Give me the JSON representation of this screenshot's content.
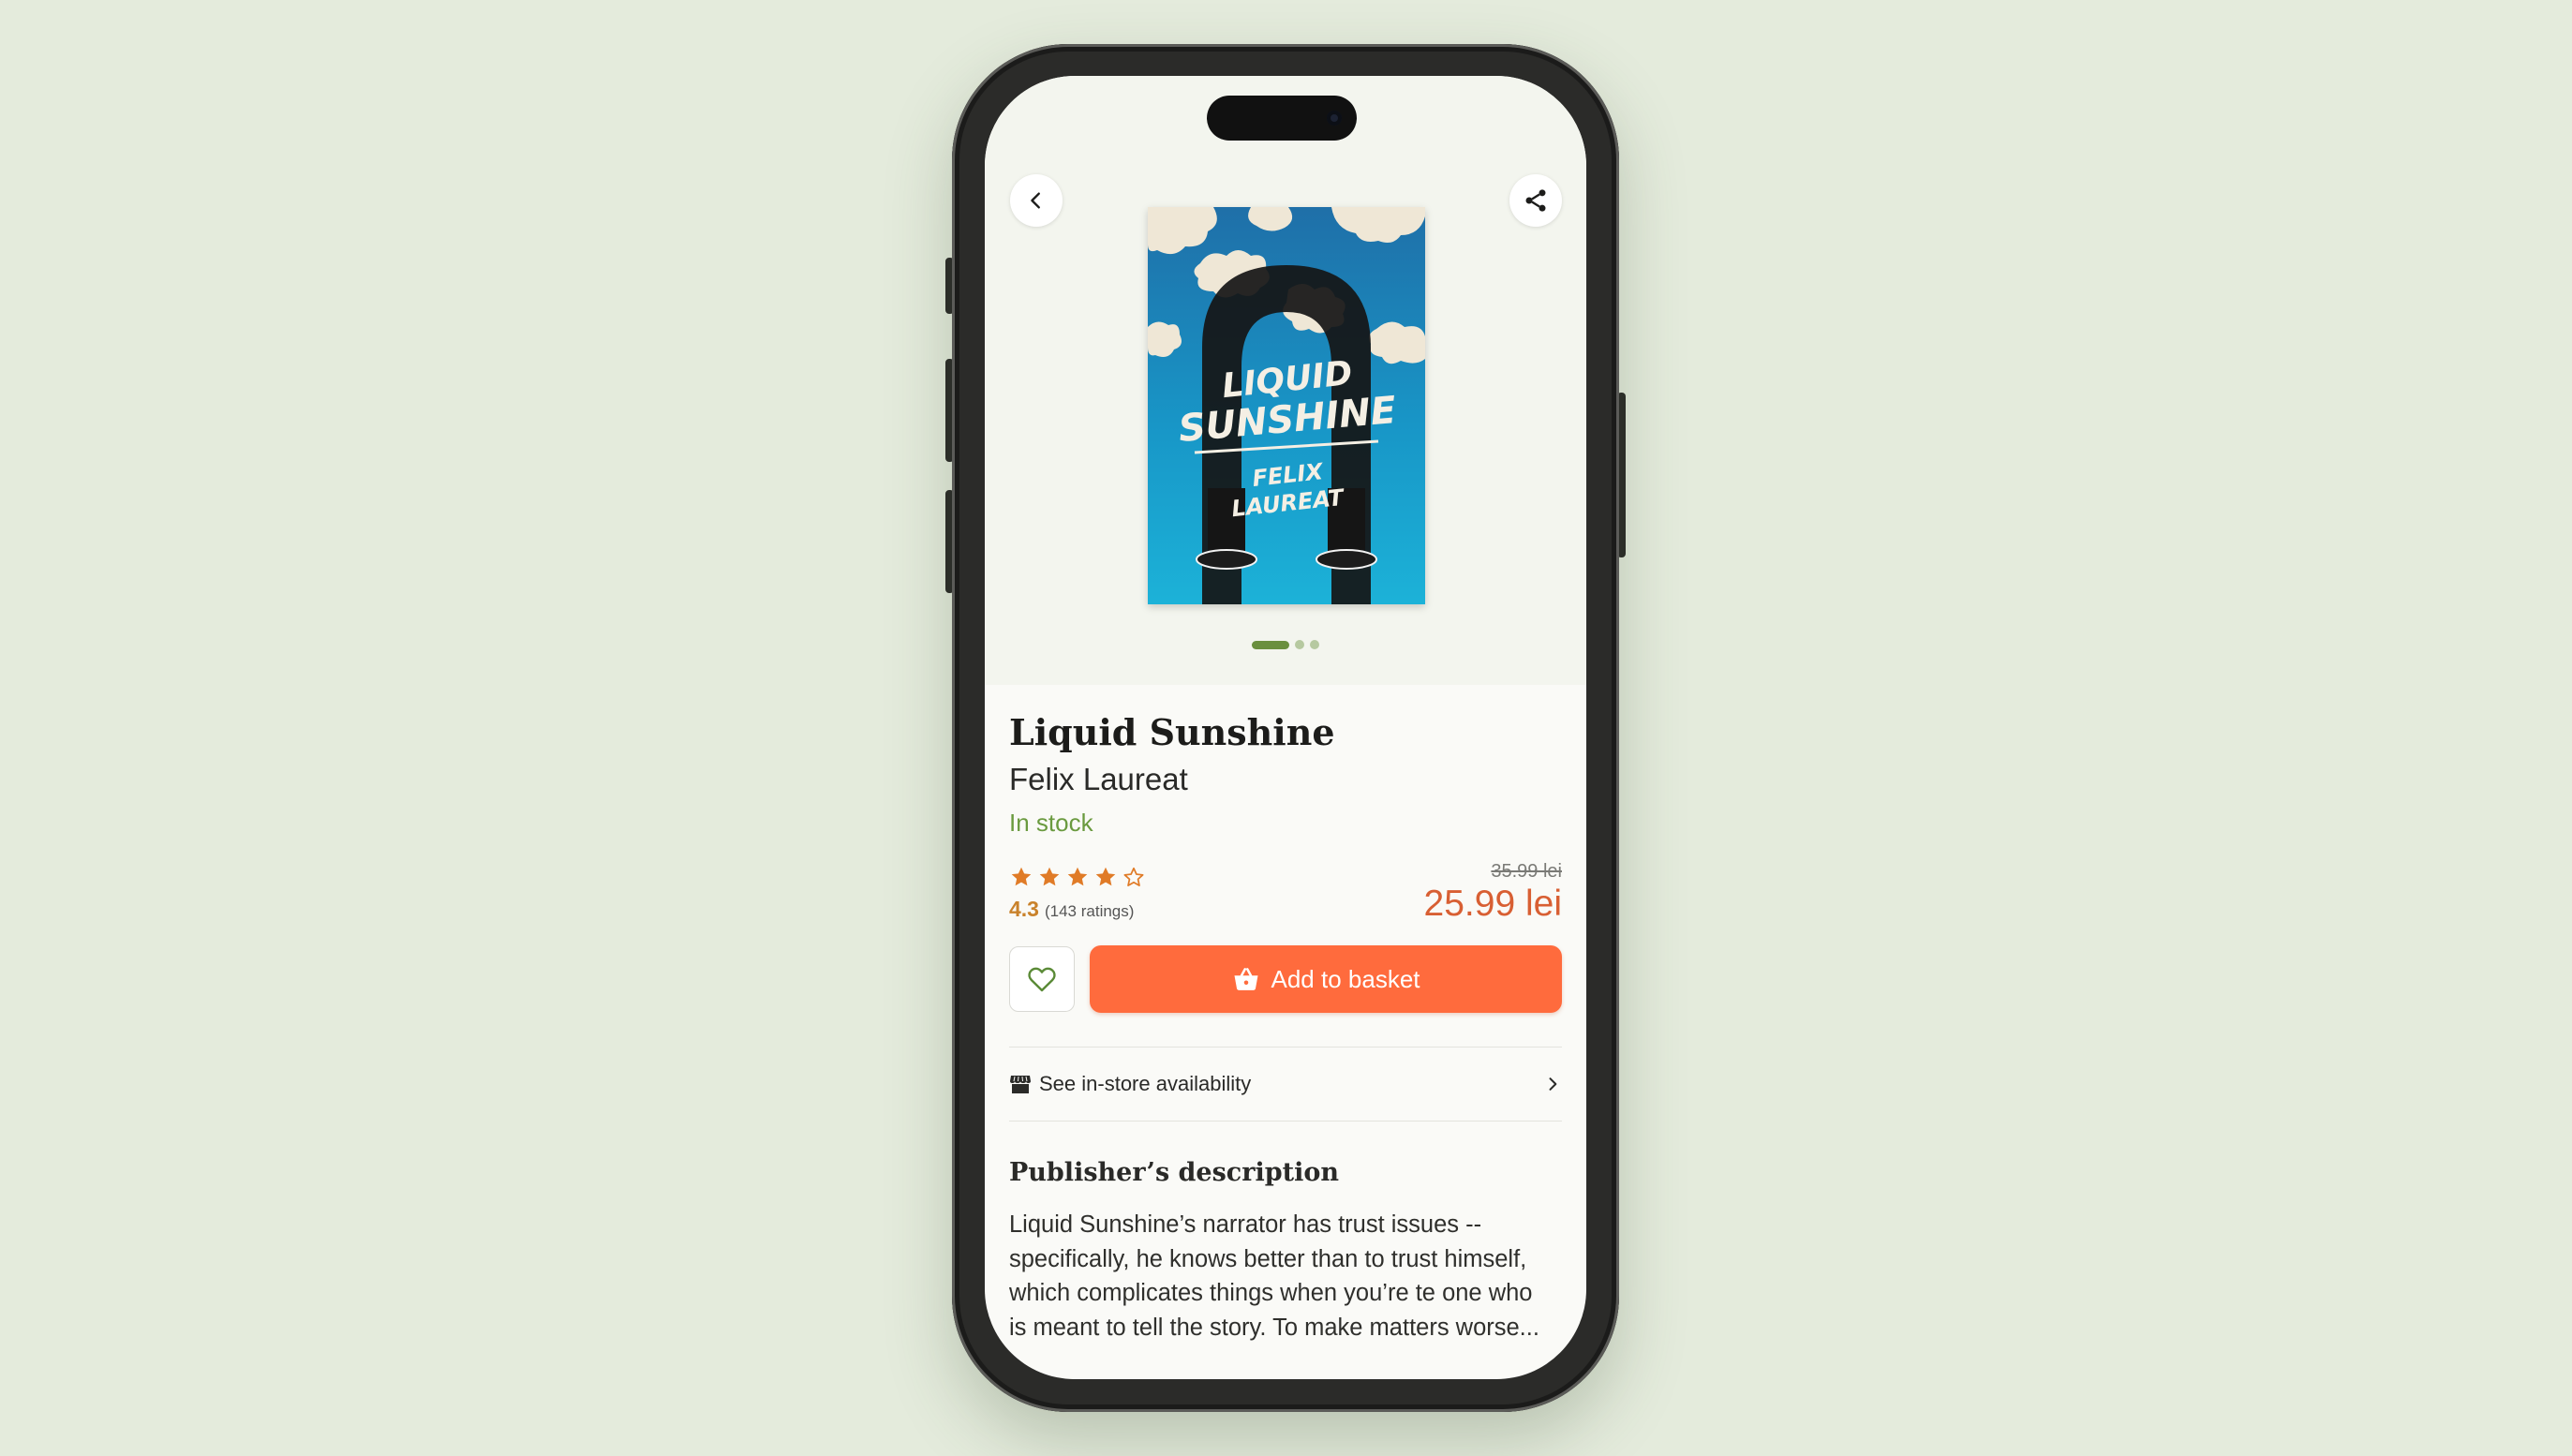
{
  "book": {
    "title": "Liquid Sunshine",
    "author": "Felix Laureat",
    "stock_status": "In stock",
    "rating": "4.3",
    "ratings_count": "(143 ratings)",
    "stars_filled": 4,
    "stars_total": 5,
    "old_price": "35.99 lei",
    "price": "25.99 lei",
    "cover": {
      "title_line1": "LIQUID",
      "title_line2": "SUNSHINE",
      "author_line1": "FELIX",
      "author_line2": "LAUREAT"
    },
    "gallery_page": 1,
    "gallery_pages": 3
  },
  "actions": {
    "add_to_basket": "Add to basket",
    "store_availability": "See in-store availability"
  },
  "description": {
    "heading": "Publisher’s description",
    "lines": [
      "Liquid Sunshine’s narrator has trust issues --",
      "specifically, he knows better than to trust himself,",
      "which complicates things when you’re te one who",
      "is meant to tell the story. To make matters worse..."
    ]
  },
  "icons": {
    "back": "chevron-left-icon",
    "share": "share-icon",
    "wishlist": "heart-icon",
    "basket": "basket-icon",
    "store": "store-icon",
    "chevron": "chevron-right-icon"
  },
  "colors": {
    "background": "#e4ebdc",
    "accent": "#ff6b3d",
    "price": "#d85f33",
    "stock": "#6a9a3f",
    "star": "#e07b27",
    "dot_active": "#6a8f3e"
  }
}
